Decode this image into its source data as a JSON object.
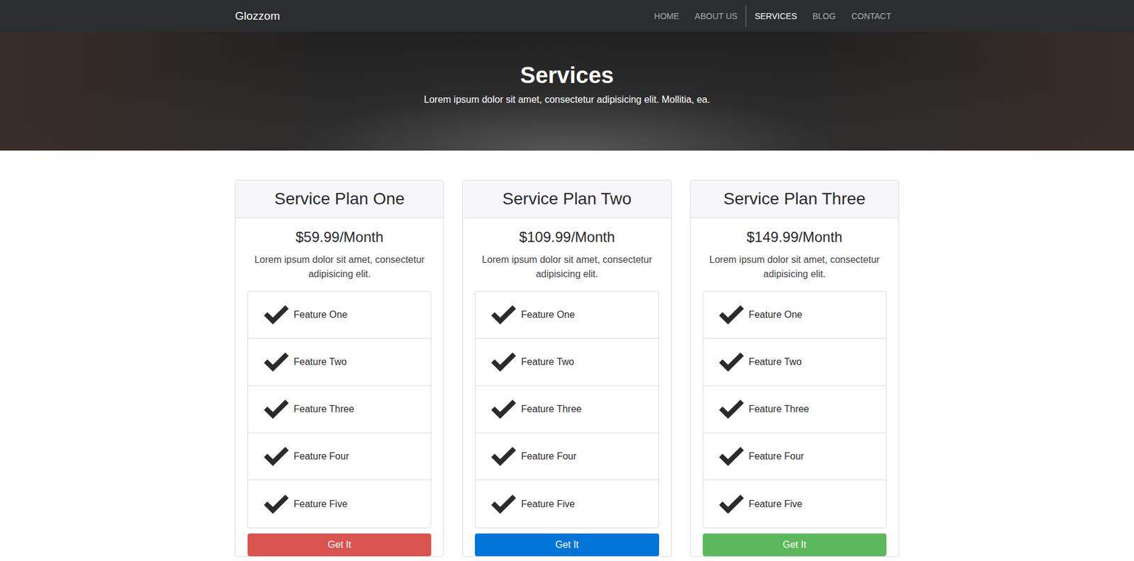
{
  "navbar": {
    "brand": "Glozzom",
    "items": [
      {
        "label": "HOME",
        "selected": false
      },
      {
        "label": "ABOUT US",
        "selected": false
      },
      {
        "label": "SERVICES",
        "selected": true
      },
      {
        "label": "BLOG",
        "selected": false
      },
      {
        "label": "CONTACT",
        "selected": false
      }
    ]
  },
  "hero": {
    "title": "Services",
    "subtitle": "Lorem ipsum dolor sit amet, consectetur adipisicing elit. Mollitia, ea."
  },
  "plans": [
    {
      "name": "Service Plan One",
      "price": "$59.99/Month",
      "description": "Lorem ipsum dolor sit amet, consectetur adipisicing elit.",
      "features": [
        "Feature One",
        "Feature Two",
        "Feature Three",
        "Feature Four",
        "Feature Five"
      ],
      "button": "Get It",
      "color": "#d9534f"
    },
    {
      "name": "Service Plan Two",
      "price": "$109.99/Month",
      "description": "Lorem ipsum dolor sit amet, consectetur adipisicing elit.",
      "features": [
        "Feature One",
        "Feature Two",
        "Feature Three",
        "Feature Four",
        "Feature Five"
      ],
      "button": "Get It",
      "color": "#0275d8"
    },
    {
      "name": "Service Plan Three",
      "price": "$149.99/Month",
      "description": "Lorem ipsum dolor sit amet, consectetur adipisicing elit.",
      "features": [
        "Feature One",
        "Feature Two",
        "Feature Three",
        "Feature Four",
        "Feature Five"
      ],
      "button": "Get It",
      "color": "#5cb85c"
    }
  ]
}
